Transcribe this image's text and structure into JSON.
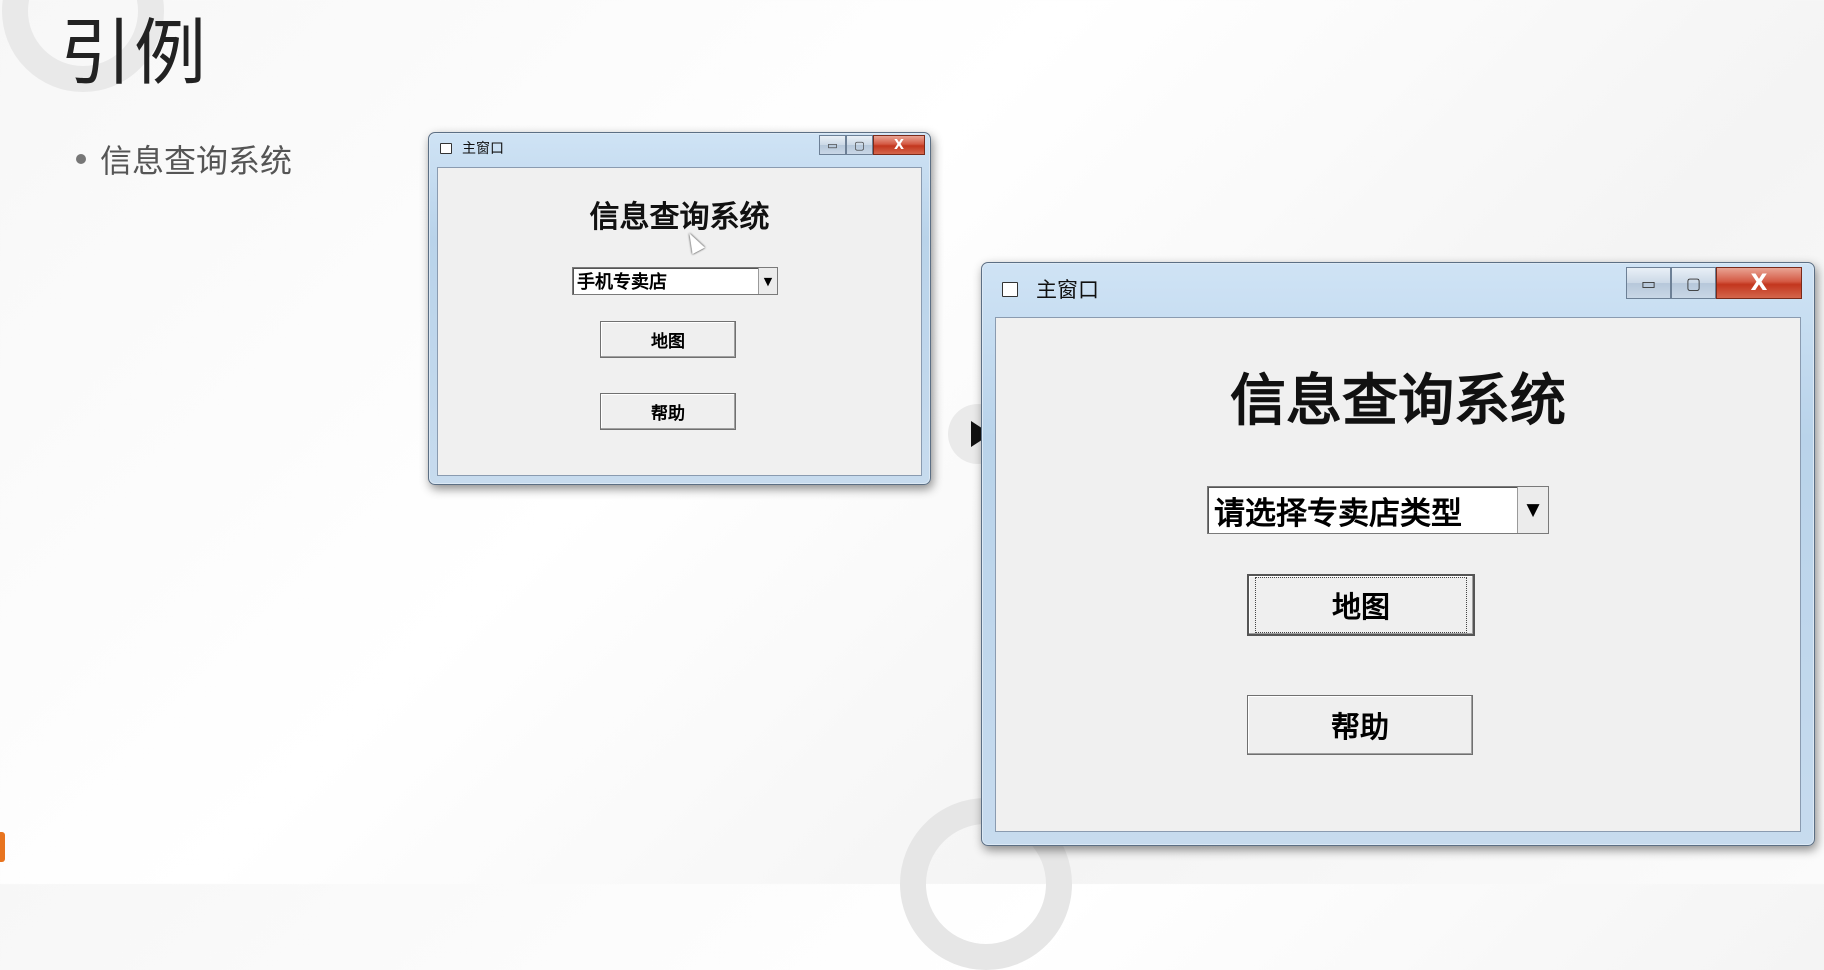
{
  "slide": {
    "title": "引例",
    "bullet": "信息查询系统"
  },
  "window_small": {
    "title": "主窗口",
    "heading": "信息查询系统",
    "combo_value": "手机专卖店",
    "map_button": "地图",
    "help_button": "帮助"
  },
  "window_large": {
    "title": "主窗口",
    "heading": "信息查询系统",
    "combo_value": "请选择专卖店类型",
    "map_button": "地图",
    "help_button": "帮助"
  },
  "window_controls": {
    "minimize": "▭",
    "maximize": "▢",
    "close": "X",
    "dropdown_arrow": "▼"
  },
  "icons": [
    "app-window-icon",
    "play-icon",
    "mouse-cursor-icon",
    "bullet-dot-icon"
  ],
  "colors": {
    "close_button": "#c3361e",
    "titlebar": "#b9d3ea",
    "client": "#f0f0f0",
    "accent_mark": "#e8741f"
  }
}
